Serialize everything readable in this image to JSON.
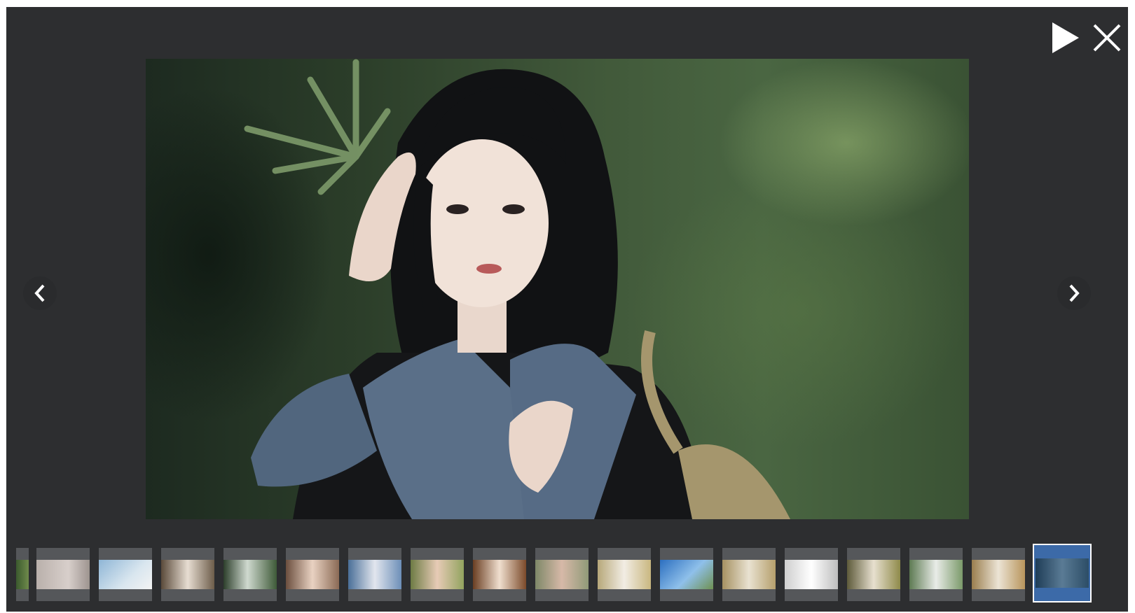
{
  "viewer": {
    "controls": {
      "play_icon": "play-icon",
      "close_icon": "close-icon"
    },
    "navigation": {
      "prev_icon": "chevron-left-icon",
      "next_icon": "chevron-right-icon"
    },
    "current_index": 18,
    "thumbnail_count": 19,
    "colors": {
      "background": "#2d2e30",
      "active_thumb": "#3c6aa8",
      "thumb_frame": "#55575a",
      "icon": "#ffffff"
    }
  }
}
